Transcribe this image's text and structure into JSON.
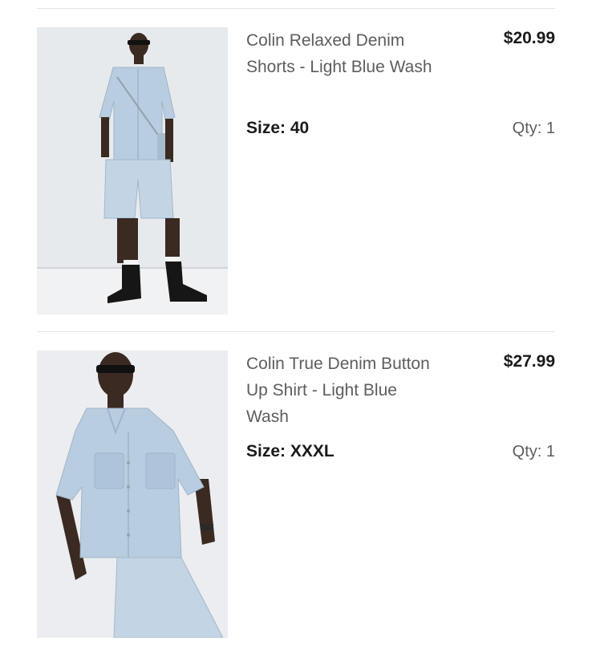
{
  "cart": {
    "items": [
      {
        "name": "Colin Relaxed Denim Shorts - Light Blue Wash",
        "price": "$20.99",
        "size_label": "Size:",
        "size_value": "40",
        "qty_label": "Qty:",
        "qty_value": "1",
        "image": "product-photo-model-denim-shorts"
      },
      {
        "name": "Colin True Denim Button Up Shirt - Light Blue Wash",
        "price": "$27.99",
        "size_label": "Size:",
        "size_value": "XXXL",
        "qty_label": "Qty:",
        "qty_value": "1",
        "image": "product-photo-model-denim-shirt"
      }
    ]
  },
  "colors": {
    "divider": "#e4e4e4",
    "name_text": "#5d5d5d",
    "price_text": "#1a1a1a",
    "denim": "#b9cde0",
    "photo_bg": "#ebedf0"
  }
}
